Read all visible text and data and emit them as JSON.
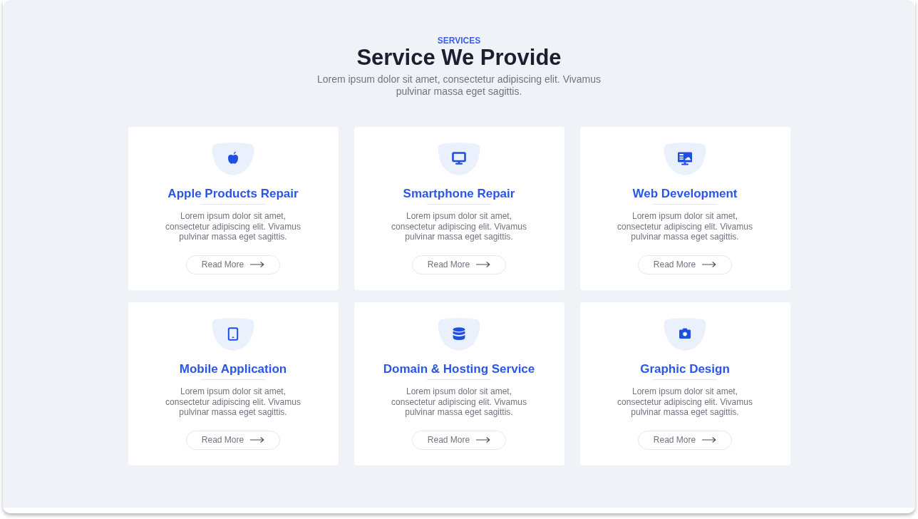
{
  "header": {
    "eyebrow": "SERVICES",
    "title": "Service We Provide",
    "description": "Lorem ipsum dolor sit amet, consectetur adipiscing elit. Vivamus pulvinar massa eget sagittis."
  },
  "services": [
    {
      "title": "Apple Products Repair",
      "description": "Lorem ipsum dolor sit amet, consectetur adipiscing elit. Vivamus pulvinar massa eget sagittis.",
      "button": "Read More"
    },
    {
      "title": "Smartphone Repair",
      "description": "Lorem ipsum dolor sit amet, consectetur adipiscing elit. Vivamus pulvinar massa eget sagittis.",
      "button": "Read More"
    },
    {
      "title": "Web Development",
      "description": "Lorem ipsum dolor sit amet, consectetur adipiscing elit. Vivamus pulvinar massa eget sagittis.",
      "button": "Read More"
    },
    {
      "title": "Mobile Application",
      "description": "Lorem ipsum dolor sit amet, consectetur adipiscing elit. Vivamus pulvinar massa eget sagittis.",
      "button": "Read More"
    },
    {
      "title": "Domain & Hosting Service",
      "description": "Lorem ipsum dolor sit amet, consectetur adipiscing elit. Vivamus pulvinar massa eget sagittis.",
      "button": "Read More"
    },
    {
      "title": "Graphic Design",
      "description": "Lorem ipsum dolor sit amet, consectetur adipiscing elit. Vivamus pulvinar massa eget sagittis.",
      "button": "Read More"
    }
  ]
}
